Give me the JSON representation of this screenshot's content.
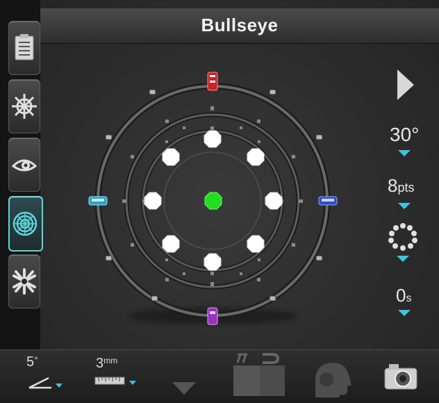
{
  "header": {
    "title": "Bullseye"
  },
  "sidebar": {
    "items": [
      {
        "name": "clipboard"
      },
      {
        "name": "ship-wheel"
      },
      {
        "name": "eye"
      },
      {
        "name": "bullseye",
        "active": true
      },
      {
        "name": "snowflake"
      }
    ]
  },
  "controls": {
    "angle": {
      "value": "30",
      "unit": "°"
    },
    "points": {
      "value": "8",
      "unit": "pts"
    },
    "delay": {
      "value": "0",
      "unit": "s"
    }
  },
  "toolbar": {
    "tilt": {
      "value": "5",
      "unit": "°"
    },
    "size": {
      "value": "3",
      "unit": "mm"
    }
  },
  "colors": {
    "accent": "#38c6e0",
    "center_point": "#22dd22",
    "marker_top": "#cc2222",
    "marker_left": "#2aa0c8",
    "marker_right": "#2e4fc8",
    "marker_bottom": "#9a2fc0"
  }
}
